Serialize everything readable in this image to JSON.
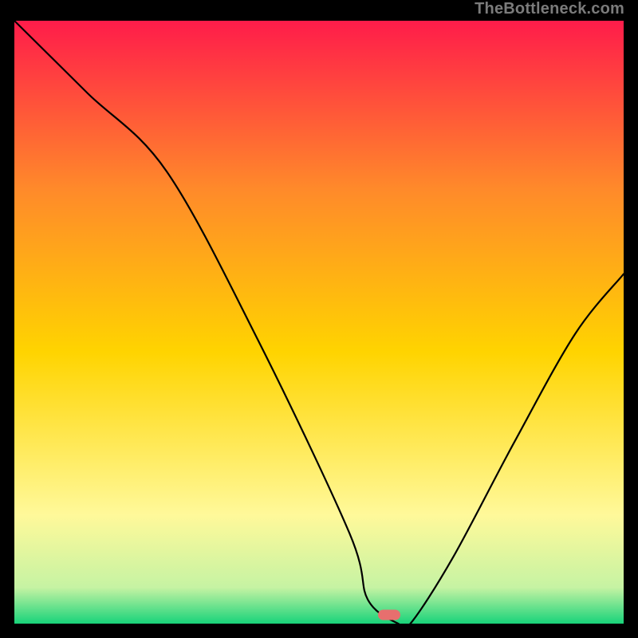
{
  "watermark": "TheBottleneck.com",
  "gradient_colors": {
    "top": "#ff1c4a",
    "upper_mid": "#ff8a2a",
    "mid": "#ffd400",
    "lower_mid": "#fff99a",
    "near_bottom": "#c6f3a3",
    "bottom": "#18d37a"
  },
  "marker": {
    "color": "#e76f6e",
    "x_norm": 0.615,
    "y_norm": 0.985
  },
  "chart_data": {
    "type": "line",
    "title": "",
    "xlabel": "",
    "ylabel": "",
    "xlim": [
      0,
      100
    ],
    "ylim": [
      0,
      100
    ],
    "series": [
      {
        "name": "curve",
        "x": [
          0,
          12,
          25,
          40,
          55,
          58,
          63,
          65,
          72,
          82,
          92,
          100
        ],
        "values": [
          100,
          88,
          75,
          47,
          15,
          4,
          0,
          0,
          11,
          30,
          48,
          58
        ]
      }
    ],
    "annotations": [
      {
        "name": "marker",
        "x": 61.5,
        "y": 0
      }
    ]
  }
}
